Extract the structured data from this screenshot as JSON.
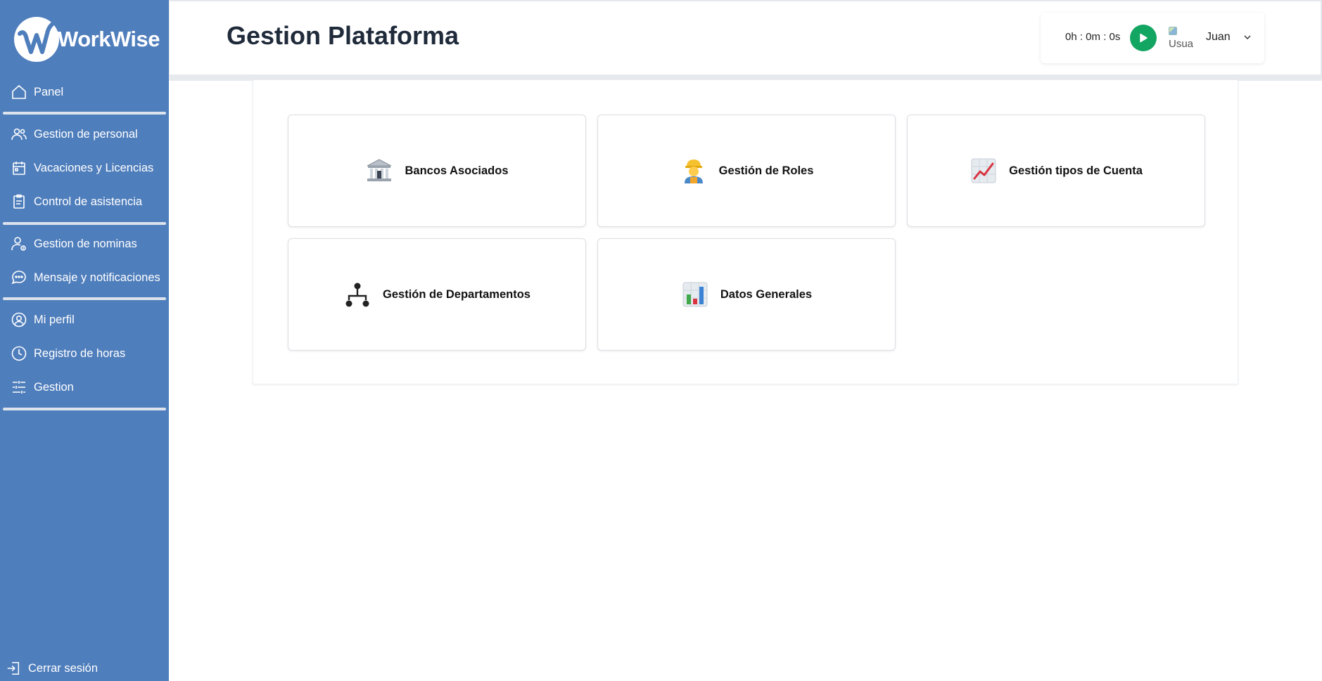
{
  "brand": {
    "name": "WorkWise"
  },
  "header": {
    "title": "Gestion Plataforma"
  },
  "timer": {
    "display": "0h : 0m : 0s"
  },
  "user": {
    "name": "Juan",
    "avatar_alt": "Usua"
  },
  "sidebar": {
    "items": [
      {
        "label": "Panel",
        "icon": "home-icon"
      },
      {
        "label": "Gestion de personal",
        "icon": "users-icon"
      },
      {
        "label": "Vacaciones y Licencias",
        "icon": "calendar-icon"
      },
      {
        "label": "Control de asistencia",
        "icon": "clipboard-icon"
      },
      {
        "label": "Gestion de nominas",
        "icon": "payroll-user-icon"
      },
      {
        "label": "Mensaje y notificaciones",
        "icon": "chat-icon"
      },
      {
        "label": "Mi perfil",
        "icon": "profile-icon"
      },
      {
        "label": "Registro de horas",
        "icon": "clock-icon"
      },
      {
        "label": "Gestion",
        "icon": "sliders-icon"
      }
    ],
    "logout_label": "Cerrar sesión"
  },
  "tiles": [
    {
      "label": "Bancos Asociados",
      "icon": "bank-icon"
    },
    {
      "label": "Gestión de Roles",
      "icon": "worker-icon"
    },
    {
      "label": "Gestión tipos de Cuenta",
      "icon": "trend-chart-icon"
    },
    {
      "label": "Gestión de Departamentos",
      "icon": "org-chart-icon"
    },
    {
      "label": "Datos Generales",
      "icon": "bar-chart-icon"
    }
  ],
  "colors": {
    "sidebar": "#4f7ebc",
    "play": "#13a562",
    "title": "#1f2a3a"
  }
}
